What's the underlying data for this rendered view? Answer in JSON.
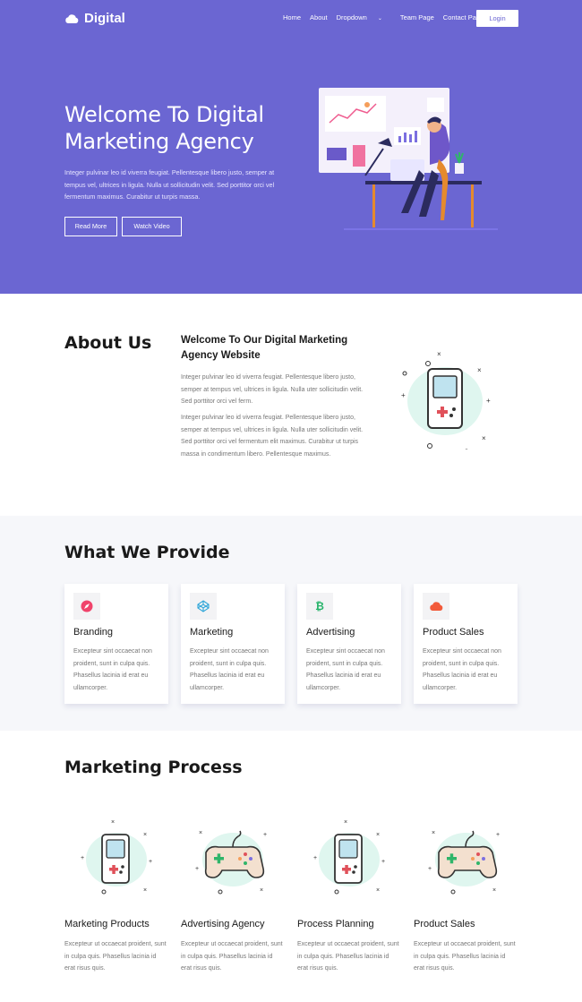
{
  "brand": {
    "name": "Digital"
  },
  "nav": {
    "items": [
      "Home",
      "About",
      "Dropdown",
      "Team Page",
      "Contact Page"
    ],
    "login_label": "Login"
  },
  "hero": {
    "title": "Welcome To Digital Marketing Agency",
    "text": "Integer pulvinar leo id viverra feugiat. Pellentesque libero justo, semper at tempus vel, ultrices in ligula. Nulla ut sollicitudin velit. Sed porttitor orci vel fermentum maximus. Curabitur ut turpis massa.",
    "read_more": "Read More",
    "watch_video": "Watch Video"
  },
  "about": {
    "heading": "About Us",
    "subheading": "Welcome To Our Digital Marketing Agency Website",
    "para1": "Integer pulvinar leo id viverra feugiat. Pellentesque libero justo, semper at tempus vel, ultrices in ligula. Nulla uter sollicitudin velit. Sed porttitor orci vel ferm.",
    "para2": "Integer pulvinar leo id viverra feugiat. Pellentesque libero justo, semper at tempus vel, ultrices in ligula. Nulla uter sollicitudin velit. Sed porttitor orci vel fermentum elit maximus. Curabitur ut turpis massa in condimentum libero. Pellentesque maximus."
  },
  "provide": {
    "heading": "What We Provide",
    "cards": [
      {
        "title": "Branding",
        "icon": "compass-icon",
        "text": "Excepteur sint occaecat non proident, sunt in culpa quis. Phasellus lacinia id erat eu ullamcorper."
      },
      {
        "title": "Marketing",
        "icon": "codepen-icon",
        "text": "Excepteur sint occaecat non proident, sunt in culpa quis. Phasellus lacinia id erat eu ullamcorper."
      },
      {
        "title": "Advertising",
        "icon": "bitcoin-icon",
        "text": "Excepteur sint occaecat non proident, sunt in culpa quis. Phasellus lacinia id erat eu ullamcorper."
      },
      {
        "title": "Product Sales",
        "icon": "cloud-icon",
        "text": "Excepteur sint occaecat non proident, sunt in culpa quis. Phasellus lacinia id erat eu ullamcorper."
      }
    ]
  },
  "process": {
    "heading": "Marketing Process",
    "items": [
      {
        "title": "Marketing Products",
        "icon": "gameboy-icon",
        "text": "Excepteur ut occaecat proident, sunt in culpa quis. Phasellus lacinia id erat risus quis."
      },
      {
        "title": "Advertising Agency",
        "icon": "gamepad-icon",
        "text": "Excepteur ut occaecat proident, sunt in culpa quis. Phasellus lacinia id erat risus quis."
      },
      {
        "title": "Process Planning",
        "icon": "gameboy-icon",
        "text": "Excepteur ut occaecat proident, sunt in culpa quis. Phasellus lacinia id erat risus quis."
      },
      {
        "title": "Product Sales",
        "icon": "gamepad-icon",
        "text": "Excepteur ut occaecat proident, sunt in culpa quis. Phasellus lacinia id erat risus quis."
      }
    ]
  },
  "colors": {
    "primary": "#6b66d2",
    "branding_icon": "#f0436b",
    "marketing_icon": "#2fa6d8",
    "advertising_icon": "#26b36a",
    "sales_icon": "#f25a3a"
  }
}
